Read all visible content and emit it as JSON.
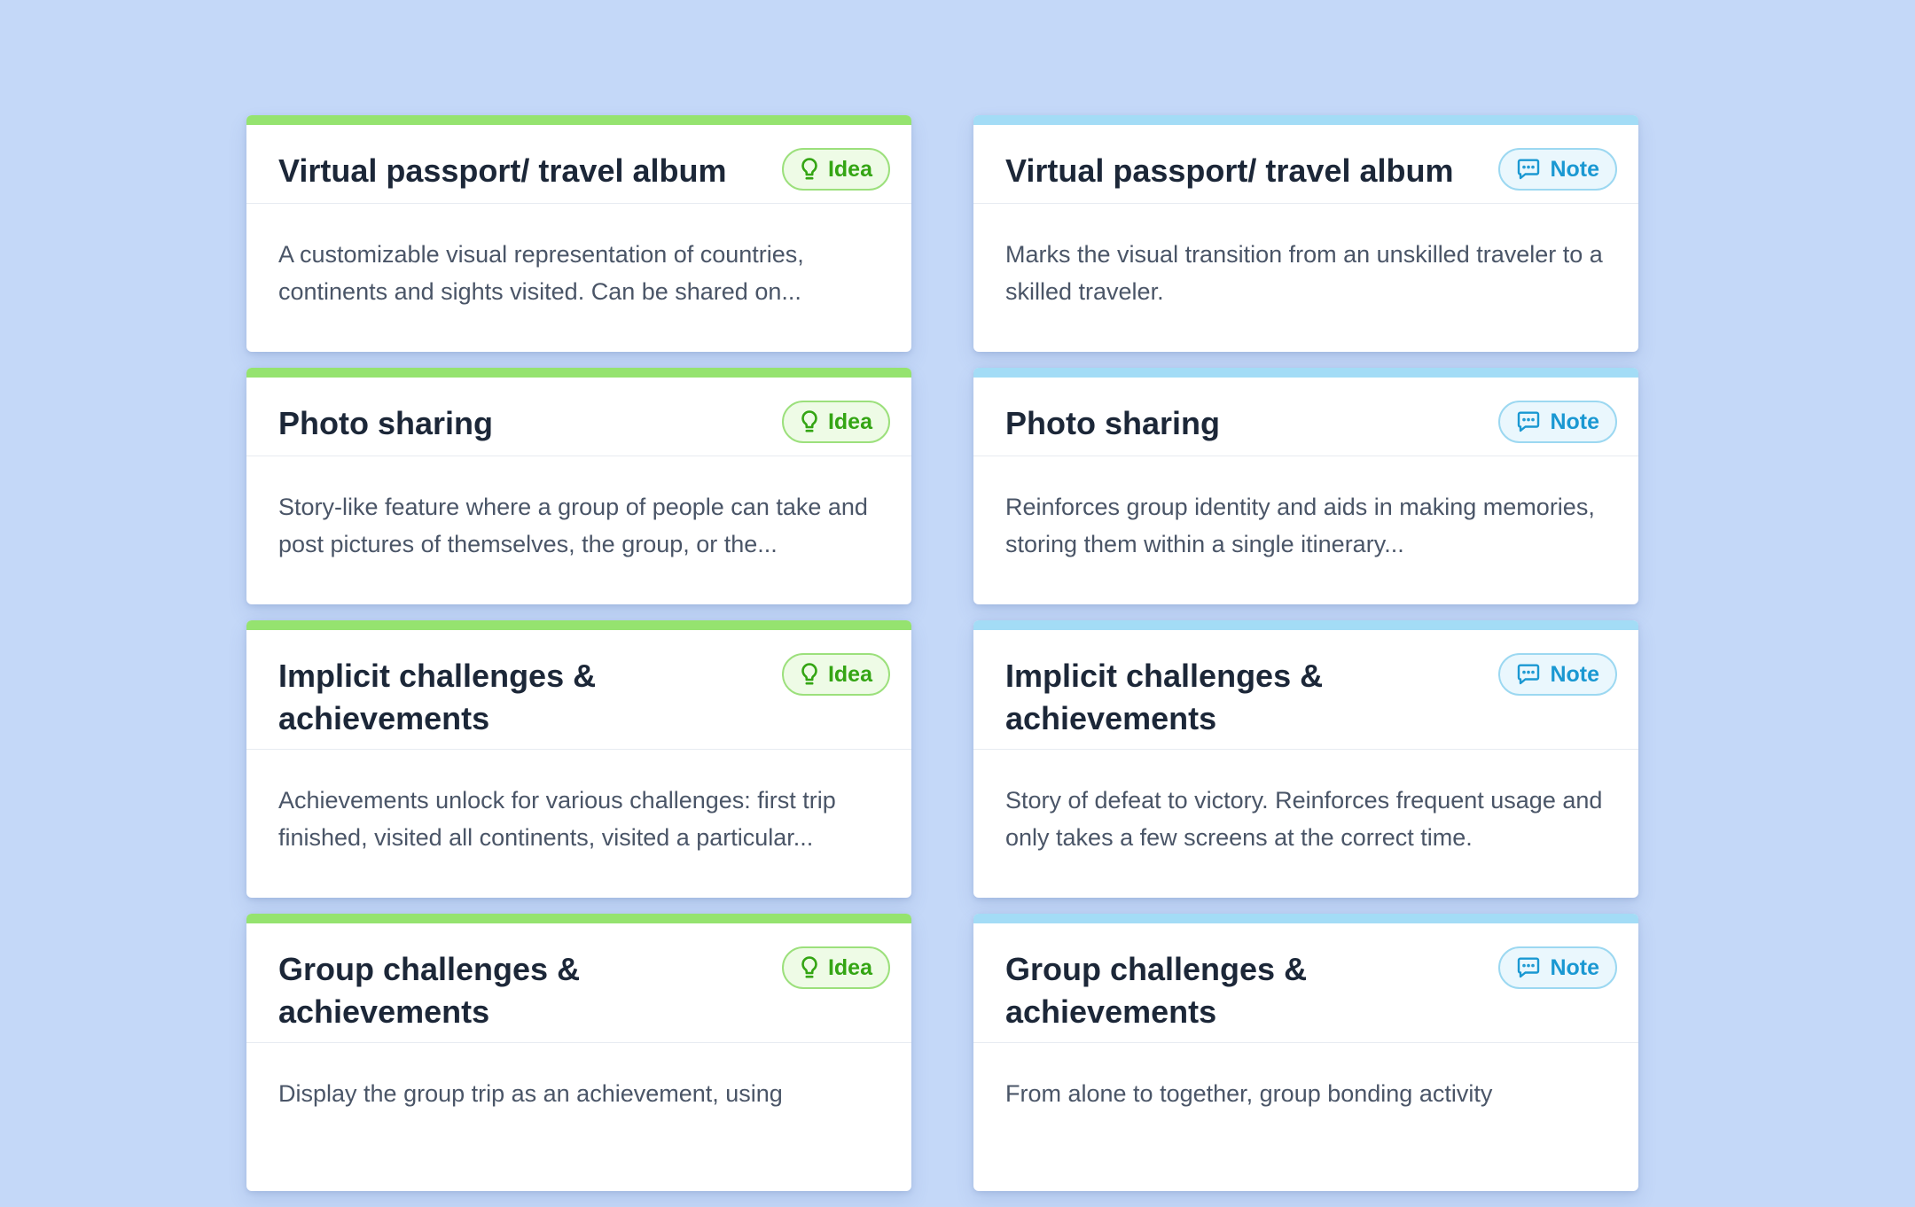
{
  "columns": [
    {
      "type": "idea",
      "cards": [
        {
          "title": "Virtual passport/ travel album",
          "badge": "Idea",
          "body": "A customizable visual representation of countries, continents and sights visited. Can be shared on..."
        },
        {
          "title": "Photo sharing",
          "badge": "Idea",
          "body": "Story-like feature where a group of people can take and post pictures of themselves, the group, or the..."
        },
        {
          "title": "Implicit challenges & achievements",
          "badge": "Idea",
          "body": "Achievements unlock for various challenges: first trip finished, visited all continents, visited a particular..."
        },
        {
          "title": "Group challenges & achievements",
          "badge": "Idea",
          "body": "Display the group trip as an achievement, using"
        }
      ]
    },
    {
      "type": "note",
      "cards": [
        {
          "title": "Virtual passport/ travel album",
          "badge": "Note",
          "body": "Marks the visual transition from an unskilled traveler to a skilled traveler."
        },
        {
          "title": "Photo sharing",
          "badge": "Note",
          "body": "Reinforces group identity and aids in making memories, storing them within a single itinerary..."
        },
        {
          "title": "Implicit challenges & achievements",
          "badge": "Note",
          "body": "Story of defeat to victory. Reinforces frequent usage and only takes a few screens at the correct time."
        },
        {
          "title": "Group challenges & achievements",
          "badge": "Note",
          "body": "From alone to together, group bonding activity"
        }
      ]
    }
  ],
  "colors": {
    "background": "#c4d8f8",
    "idea_accent": "#95e36f",
    "note_accent": "#a3dcf6",
    "idea_text": "#34a514",
    "note_text": "#1a98d2"
  },
  "icons": {
    "idea": "lightbulb-icon",
    "note": "comment-icon"
  }
}
